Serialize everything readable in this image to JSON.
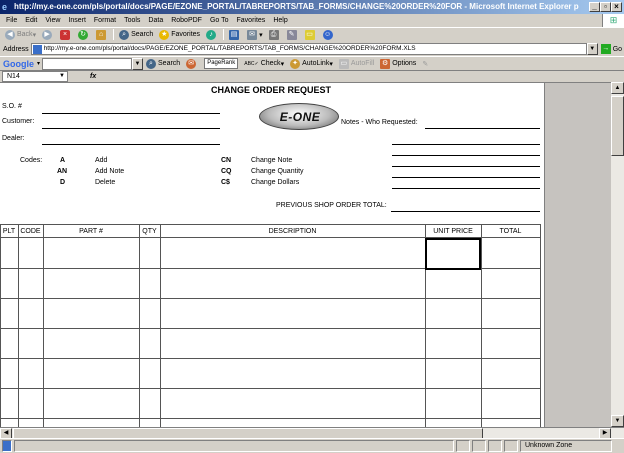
{
  "window": {
    "title": "http://my.e-one.com/pls/portal/docs/PAGE/EZONE_PORTAL/TABREPORTS/TAB_FORMS/CHANGE%20ORDER%20FOR - Microsoft Internet Explorer p",
    "controls": [
      "_",
      "▫",
      "×"
    ]
  },
  "menu": [
    "File",
    "Edit",
    "View",
    "Insert",
    "Format",
    "Tools",
    "Data",
    "RoboPDF",
    "Go To",
    "Favorites",
    "Help"
  ],
  "toolbar": {
    "back": "Back",
    "search": "Search",
    "favorites": "Favorites"
  },
  "address": {
    "label": "Address",
    "url": "http://my.e-one.com/pls/portal/docs/PAGE/EZONE_PORTAL/TABREPORTS/TAB_FORMS/CHANGE%20ORDER%20FORM.XLS",
    "go": "Go"
  },
  "google": {
    "logo": "Google",
    "search": "Search",
    "pagerank": "PageRank",
    "check": "Check",
    "autolink": "AutoLink",
    "autofill": "AutoFill",
    "options": "Options"
  },
  "formula": {
    "cell_ref": "N14",
    "fx": "fx"
  },
  "form": {
    "title": "CHANGE ORDER REQUEST",
    "so_label": "S.O. #",
    "customer_label": "Customer:",
    "dealer_label": "Dealer:",
    "notes_label": "Notes - Who Requested:",
    "logo_text": "E-ONE",
    "codes_label": "Codes:",
    "codes": [
      {
        "code": "A",
        "desc": "Add"
      },
      {
        "code": "AN",
        "desc": "Add Note"
      },
      {
        "code": "D",
        "desc": "Delete"
      }
    ],
    "codes2": [
      {
        "code": "CN",
        "desc": "Change Note"
      },
      {
        "code": "CQ",
        "desc": "Change Quantity"
      },
      {
        "code": "C$",
        "desc": "Change Dollars"
      }
    ],
    "prev_total_label": "PREVIOUS SHOP ORDER TOTAL:",
    "columns": [
      "PLT",
      "CODE",
      "PART #",
      "QTY",
      "DESCRIPTION",
      "UNIT PRICE",
      "TOTAL"
    ]
  },
  "status": {
    "zone": "Unknown Zone"
  }
}
